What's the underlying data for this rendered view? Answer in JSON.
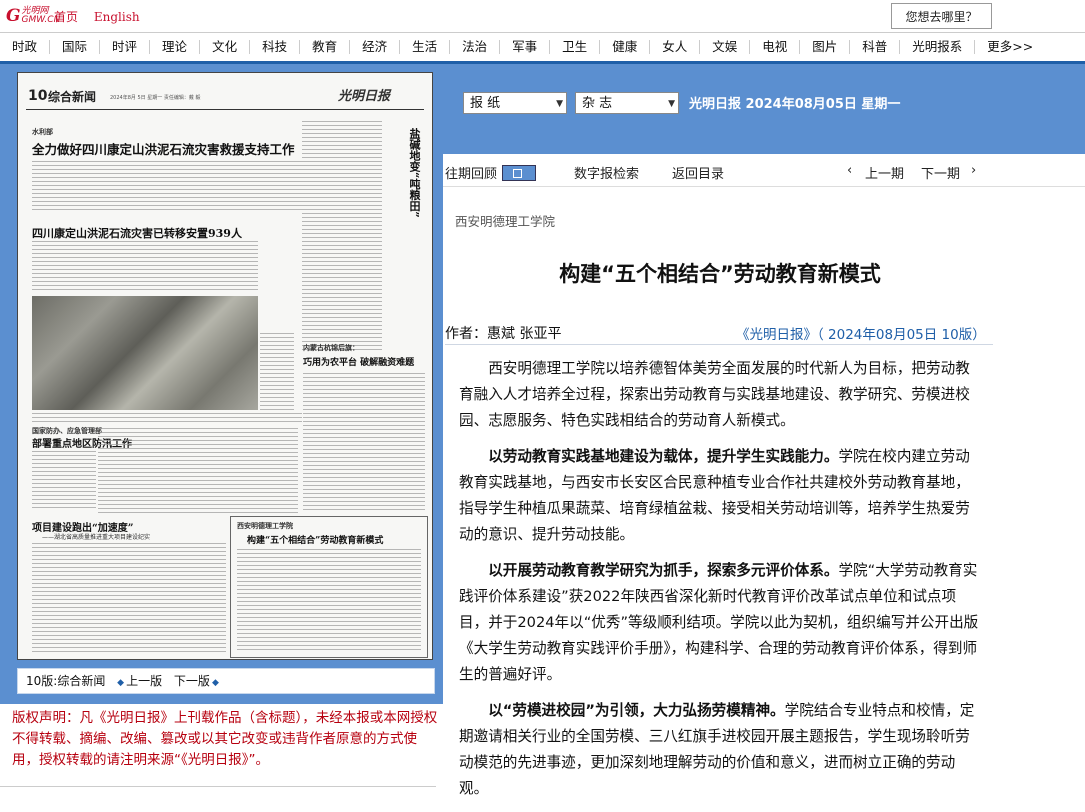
{
  "top": {
    "logo_main": "G",
    "logo_small": "光明网\nGMW.CN",
    "links": [
      "首页",
      "English"
    ],
    "search_button": "您想去哪里？"
  },
  "nav": [
    "时政",
    "国际",
    "时评",
    "理论",
    "文化",
    "科技",
    "教育",
    "经济",
    "生活",
    "法治",
    "军事",
    "卫生",
    "健康",
    "女人",
    "文娱",
    "电视",
    "图片",
    "科普",
    "光明报系",
    "更多>>"
  ],
  "paper": {
    "page_number": "10",
    "page_name": "综合新闻",
    "info_line": "2024年8月 5日 星期一 责任编辑：戴 毅",
    "brand": "光明日报",
    "headlines": {
      "h1_tag": "水利部",
      "h1": "全力做好四川康定山洪泥石流灾害救援支持工作",
      "h2": "四川康定山洪泥石流灾害已转移安置939人",
      "h3_tag": "国家防办、应急管理部",
      "h3": "部署重点地区防汛工作",
      "h4": "项目建设跑出“加速度”",
      "h4_sub": "——湖北省高质量推进重大项目建设纪实",
      "h5_tag": "内蒙古杭锦后旗：",
      "h5": "巧用为农平台  破解融资难题",
      "vertical": "盐碱地变“吨粮田”",
      "box_tag": "西安明德理工学院",
      "box_title": "构建“五个相结合”劳动教育新模式"
    },
    "pager": {
      "label": "10版:综合新闻",
      "prev": "上一版",
      "next": "下一版"
    }
  },
  "copyright": "版权声明：凡《光明日报》上刊载作品（含标题），未经本报或本网授权不得转载、摘编、改编、篡改或以其它改变或违背作者原意的方式使用，授权转载的请注明来源“《光明日报》”。",
  "right": {
    "select_newspaper": "报  纸",
    "select_magazine": "杂  志",
    "date_line": "光明日报  2024年08月05日  星期一",
    "subnav": {
      "archive": "往期回顾",
      "digital_search": "数字报检索",
      "back_toc": "返回目录",
      "prev_period": "上一期",
      "next_period": "下一期"
    },
    "org": "西安明德理工学院",
    "title": "构建“五个相结合”劳动教育新模式",
    "author": "作者：惠斌 张亚平",
    "source": "《光明日报》（ 2024年08月05日  10版）",
    "paragraphs": [
      {
        "bold": "",
        "text": "西安明德理工学院以培养德智体美劳全面发展的时代新人为目标，把劳动教育融入人才培养全过程，探索出劳动教育与实践基地建设、教学研究、劳模进校园、志愿服务、特色实践相结合的劳动育人新模式。"
      },
      {
        "bold": "以劳动教育实践基地建设为载体，提升学生实践能力。",
        "text": "学院在校内建立劳动教育实践基地，与西安市长安区合民意种植专业合作社共建校外劳动教育基地，指导学生种植瓜果蔬菜、培育绿植盆栽、接受相关劳动培训等，培养学生热爱劳动的意识、提升劳动技能。"
      },
      {
        "bold": "以开展劳动教育教学研究为抓手，探索多元评价体系。",
        "text": "学院“大学劳动教育实践评价体系建设”获2022年陕西省深化新时代教育评价改革试点单位和试点项目，并于2024年以“优秀”等级顺利结项。学院以此为契机，组织编写并公开出版《大学生劳动教育实践评价手册》，构建科学、合理的劳动教育评价体系，得到师生的普遍好评。"
      },
      {
        "bold": "以“劳模进校园”为引领，大力弘扬劳模精神。",
        "text": "学院结合专业特点和校情，定期邀请相关行业的全国劳模、三八红旗手进校园开展主题报告，学生现场聆听劳动模范的先进事迹，更加深刻地理解劳动的价值和意义，进而树立正确的劳动观。"
      }
    ]
  }
}
